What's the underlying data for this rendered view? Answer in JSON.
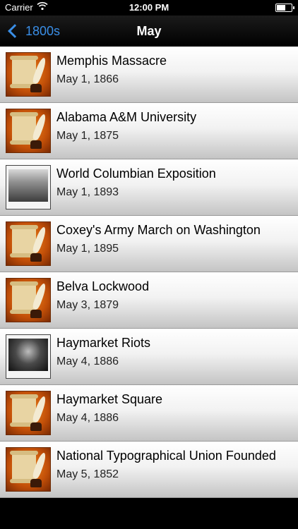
{
  "status_bar": {
    "carrier": "Carrier",
    "time": "12:00 PM"
  },
  "nav": {
    "back_label": "1800s",
    "title": "May"
  },
  "events": [
    {
      "title": "Memphis Massacre",
      "date": "May 1, 1866",
      "thumb": "parchment-quill-icon"
    },
    {
      "title": "Alabama A&M University",
      "date": "May 1, 1875",
      "thumb": "parchment-quill-icon"
    },
    {
      "title": "World Columbian Exposition",
      "date": "May 1, 1893",
      "thumb": "exposition-photo"
    },
    {
      "title": "Coxey's Army March on Washington",
      "date": "May 1, 1895",
      "thumb": "parchment-quill-icon"
    },
    {
      "title": "Belva Lockwood",
      "date": "May 3, 1879",
      "thumb": "parchment-quill-icon"
    },
    {
      "title": "Haymarket Riots",
      "date": "May 4, 1886",
      "thumb": "riot-photo"
    },
    {
      "title": "Haymarket Square",
      "date": "May 4, 1886",
      "thumb": "parchment-quill-icon"
    },
    {
      "title": "National Typographical Union Founded",
      "date": "May 5, 1852",
      "thumb": "parchment-quill-icon"
    }
  ]
}
